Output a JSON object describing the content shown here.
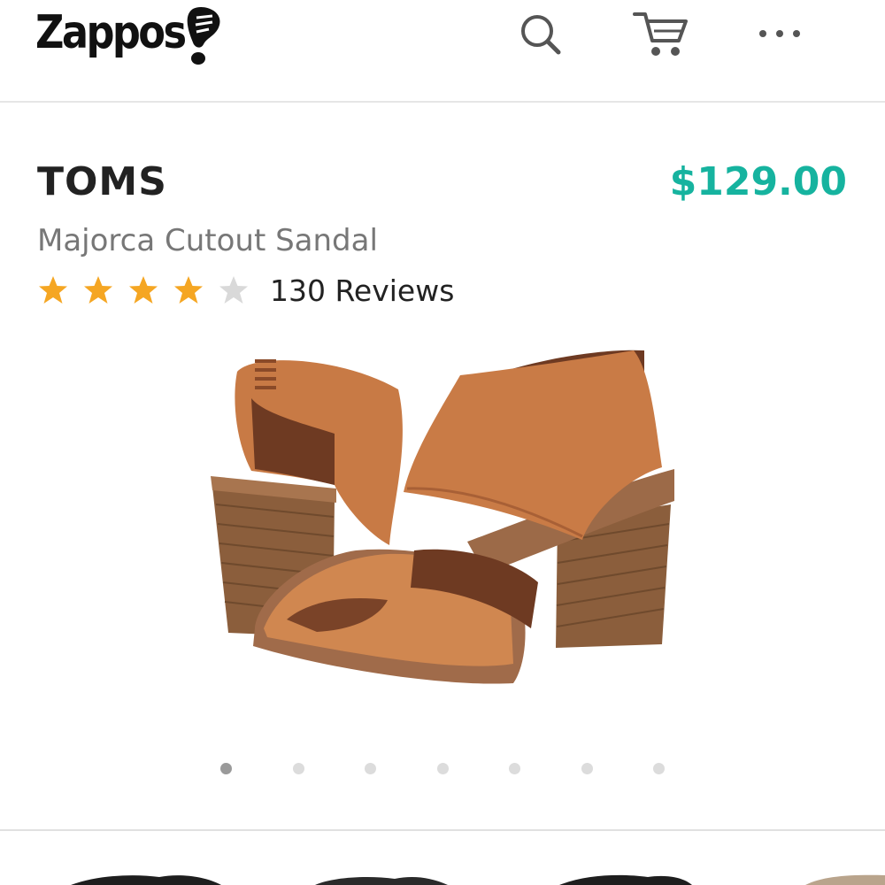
{
  "header": {
    "logo_text": "Zappos",
    "icons": [
      "search-icon",
      "cart-icon",
      "more-icon"
    ]
  },
  "product": {
    "brand": "TOMS",
    "price": "$129.00",
    "name": "Majorca Cutout Sandal",
    "rating": 4,
    "rating_max": 5,
    "reviews_label": "130 Reviews"
  },
  "carousel": {
    "image_count": 7,
    "active_index": 0
  },
  "colors": {
    "price": "#16b39f",
    "star_filled": "#f5a623",
    "star_empty": "#d9d9d9"
  }
}
